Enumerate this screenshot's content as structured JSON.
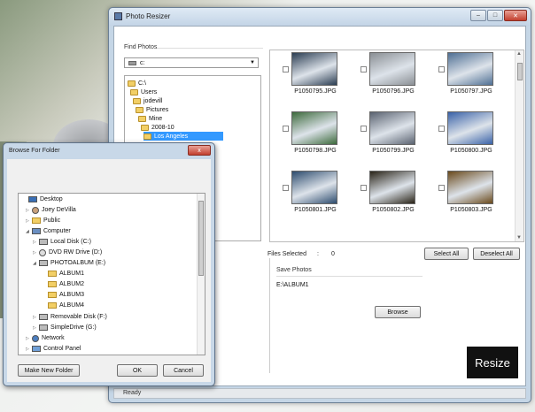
{
  "app": {
    "title": "Photo Resizer",
    "find_photos_label": "Find Photos",
    "drive": "c:",
    "tree": [
      "C:\\",
      "Users",
      "jodevill",
      "Pictures",
      "Mine",
      "2008-10",
      "Los Angeles"
    ],
    "photos": [
      {
        "name": "P1050795.JPG",
        "color": "#2b3d52"
      },
      {
        "name": "P1050796.JPG",
        "color": "#8a8f94"
      },
      {
        "name": "P1050797.JPG",
        "color": "#4f6f94"
      },
      {
        "name": "P1050798.JPG",
        "color": "#3d6a3c"
      },
      {
        "name": "P1050799.JPG",
        "color": "#5a6270"
      },
      {
        "name": "P1050800.JPG",
        "color": "#3a62a8"
      },
      {
        "name": "P1050801.JPG",
        "color": "#2d4c6e"
      },
      {
        "name": "P1050802.JPG",
        "color": "#2a2418"
      },
      {
        "name": "P1050803.JPG",
        "color": "#6a4a1c"
      }
    ],
    "files_selected_label": "Files Selected",
    "files_selected_colon": ":",
    "files_selected_value": "0",
    "select_all": "Select All",
    "deselect_all": "Deselect All",
    "save_photos_label": "Save Photos",
    "save_path": "E:\\ALBUM1",
    "browse": "Browse",
    "resize": "Resize",
    "status": "Ready"
  },
  "dialog": {
    "title": "Browse For Folder",
    "close": "x",
    "items": [
      {
        "label": "Desktop",
        "icon": "desktop-icon"
      },
      {
        "label": "Joey DeVilla",
        "icon": "user-icon"
      },
      {
        "label": "Public",
        "icon": "folder-icon"
      },
      {
        "label": "Computer",
        "icon": "computer-icon"
      },
      {
        "label": "Local Disk (C:)",
        "icon": "drive-icon"
      },
      {
        "label": "DVD RW Drive (D:)",
        "icon": "dvd-icon"
      },
      {
        "label": "PHOTOALBUM (E:)",
        "icon": "drive-icon"
      },
      {
        "label": "ALBUM1",
        "icon": "folder-icon"
      },
      {
        "label": "ALBUM2",
        "icon": "folder-icon"
      },
      {
        "label": "ALBUM3",
        "icon": "folder-icon"
      },
      {
        "label": "ALBUM4",
        "icon": "folder-icon"
      },
      {
        "label": "Removable Disk (F:)",
        "icon": "drive-icon"
      },
      {
        "label": "SimpleDrive (G:)",
        "icon": "drive-icon"
      },
      {
        "label": "Network",
        "icon": "network-icon"
      },
      {
        "label": "Control Panel",
        "icon": "control-panel-icon"
      }
    ],
    "make_new_folder": "Make New Folder",
    "ok": "OK",
    "cancel": "Cancel"
  }
}
